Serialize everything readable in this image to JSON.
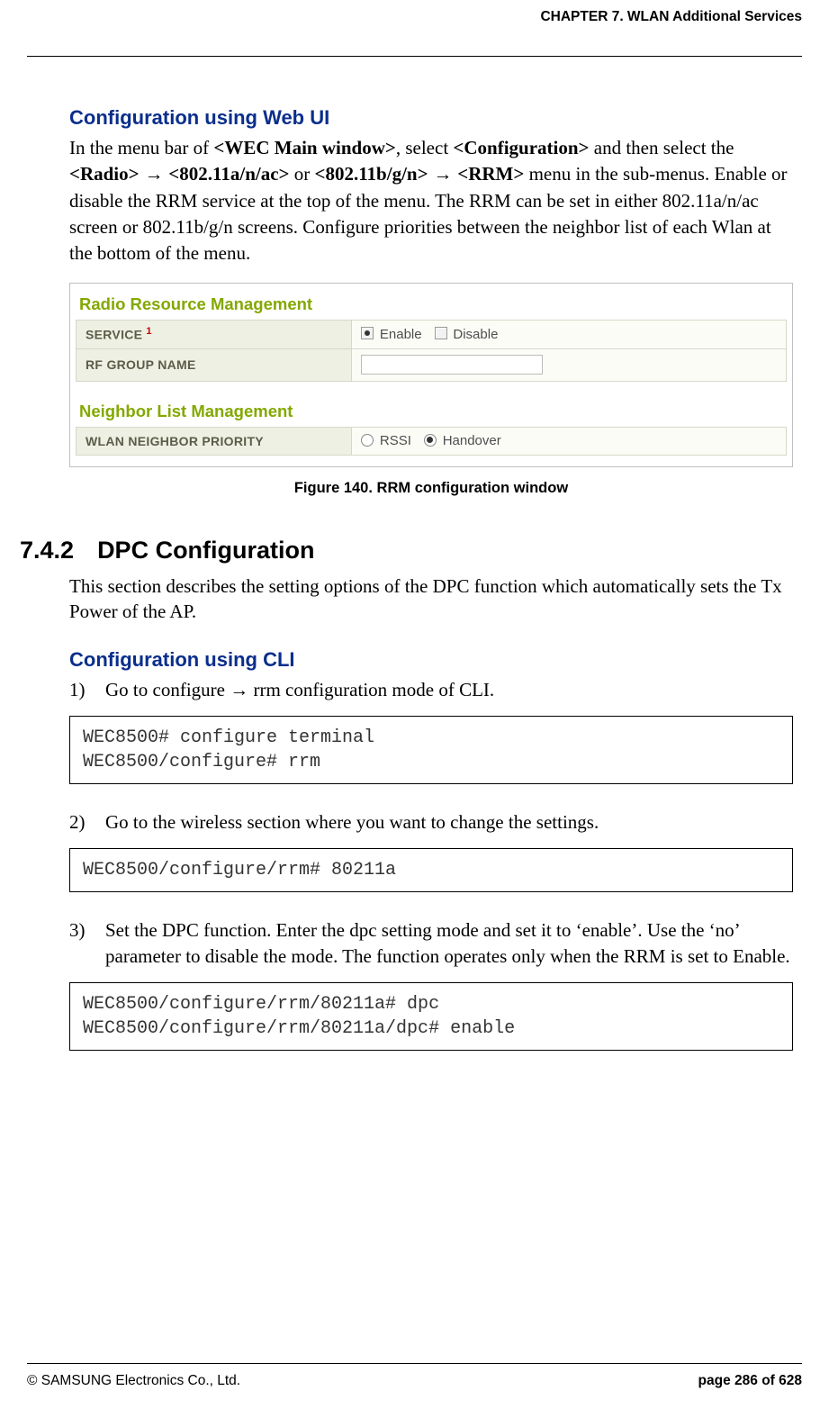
{
  "header": {
    "chapter": "CHAPTER 7. WLAN Additional Services"
  },
  "s1": {
    "h3": "Configuration using Web UI",
    "p_a": "In the menu bar of ",
    "p_b": "<WEC Main window>",
    "p_c": ", select ",
    "p_d": "<Configuration>",
    "p_e": " and then select the ",
    "p_f": "<Radio>",
    "p_g": " → ",
    "p_h": "<802.11a/n/ac>",
    "p_i": " or ",
    "p_j": "<802.11b/g/n>",
    "p_k": " → ",
    "p_l": "<RRM>",
    "p_m": " menu in the sub-menus. Enable or disable the RRM service at the top of the menu. The RRM can be set in either 802.11a/n/ac screen or 802.11b/g/n screens. Configure priorities between the neighbor list of each Wlan at the bottom of the menu."
  },
  "figure": {
    "rrm_title": "Radio Resource Management",
    "row1_label": "SERVICE",
    "row1_sup": "1",
    "enable": "Enable",
    "disable": "Disable",
    "row2_label": "RF GROUP NAME",
    "nlm_title": "Neighbor List Management",
    "row3_label": "WLAN NEIGHBOR PRIORITY",
    "rssi": "RSSI",
    "handover": "Handover",
    "caption": "Figure 140. RRM configuration window"
  },
  "s2": {
    "num": "7.4.2",
    "title": "DPC Configuration",
    "intro": "This section describes the setting options of the DPC function which automatically sets the Tx Power of the AP.",
    "h3": "Configuration using CLI",
    "li1_marker": "1)",
    "li1_text": "Go to configure → rrm configuration mode of CLI.",
    "code1": "WEC8500# configure terminal\nWEC8500/configure# rrm",
    "li2_marker": "2)",
    "li2_text": "Go to the wireless section where you want to change the settings.",
    "code2": "WEC8500/configure/rrm# 80211a",
    "li3_marker": "3)",
    "li3_text": "Set the DPC function. Enter the dpc setting mode and set it to ‘enable’. Use the ‘no’ parameter to disable the mode. The function operates only when the RRM is set to Enable.",
    "code3": "WEC8500/configure/rrm/80211a# dpc\nWEC8500/configure/rrm/80211a/dpc# enable"
  },
  "footer": {
    "left": "© SAMSUNG Electronics Co., Ltd.",
    "right": "page 286 of 628"
  }
}
